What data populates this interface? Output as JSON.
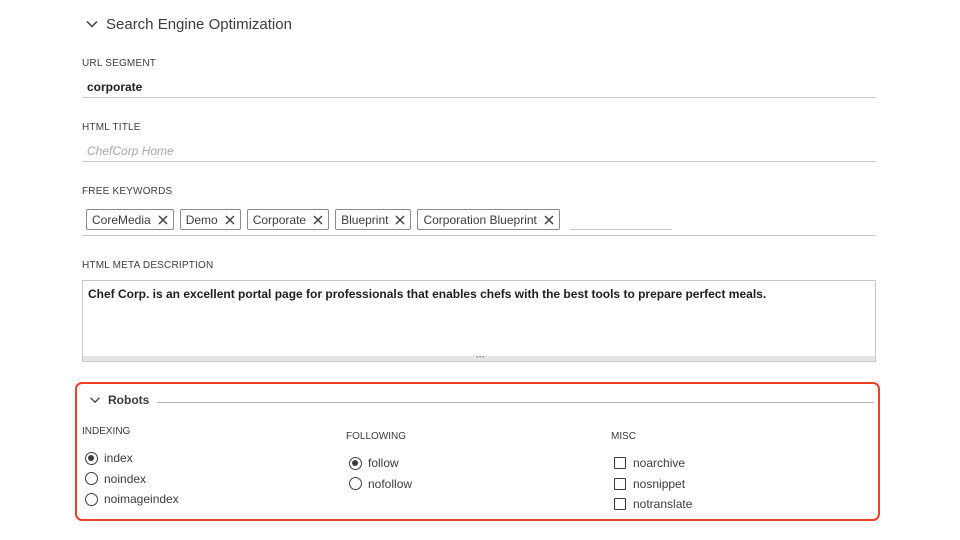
{
  "seo": {
    "section_title": "Search Engine Optimization",
    "url_segment": {
      "label": "URL SEGMENT",
      "value": "corporate"
    },
    "html_title": {
      "label": "HTML TITLE",
      "placeholder": "ChefCorp Home"
    },
    "free_keywords": {
      "label": "FREE KEYWORDS",
      "tags": [
        "CoreMedia",
        "Demo",
        "Corporate",
        "Blueprint",
        "Corporation Blueprint"
      ]
    },
    "meta_description": {
      "label": "HTML META DESCRIPTION",
      "value": "Chef Corp. is an excellent portal page for professionals that enables chefs with the best tools to prepare perfect meals."
    }
  },
  "robots": {
    "title": "Robots",
    "indexing": {
      "label": "INDEXING",
      "options": [
        "index",
        "noindex",
        "noimageindex"
      ],
      "selected": "index"
    },
    "following": {
      "label": "FOLLOWING",
      "options": [
        "follow",
        "nofollow"
      ],
      "selected": "follow"
    },
    "misc": {
      "label": "MISC",
      "options": [
        "noarchive",
        "nosnippet",
        "notranslate"
      ],
      "checked": []
    }
  },
  "colors": {
    "highlight": "#e8402a",
    "text": "#3c3c3c",
    "placeholder": "#a8a8a8"
  }
}
